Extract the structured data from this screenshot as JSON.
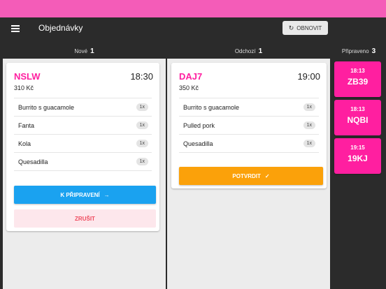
{
  "app": {
    "title": "Objednávky",
    "refresh_label": "OBNOVIT"
  },
  "columns": [
    {
      "label": "Nové",
      "count": "1"
    },
    {
      "label": "Odchozí",
      "count": "1"
    },
    {
      "label": "Připraveno",
      "count": "3"
    }
  ],
  "new_orders": [
    {
      "code": "NSLW",
      "time": "18:30",
      "price": "310 Kč",
      "items": [
        {
          "name": "Burrito s guacamole",
          "qty": "1x"
        },
        {
          "name": "Fanta",
          "qty": "1x"
        },
        {
          "name": "Kola",
          "qty": "1x"
        },
        {
          "name": "Quesadilla",
          "qty": "1x"
        }
      ],
      "prepare_label": "K PŘIPRAVENÍ",
      "cancel_label": "ZRUŠIT"
    }
  ],
  "outgoing_orders": [
    {
      "code": "DAJ7",
      "time": "19:00",
      "price": "350 Kč",
      "items": [
        {
          "name": "Burrito s guacamole",
          "qty": "1x"
        },
        {
          "name": "Pulled pork",
          "qty": "1x"
        },
        {
          "name": "Quesadilla",
          "qty": "1x"
        }
      ],
      "confirm_label": "POTVRDIT"
    }
  ],
  "ready_orders": [
    {
      "time": "18:13",
      "code": "ZB39"
    },
    {
      "time": "18:13",
      "code": "NQBI"
    },
    {
      "time": "19:15",
      "code": "19KJ"
    }
  ],
  "colors": {
    "status_bar": "#f45cb8",
    "accent_pink": "#ff1fa0",
    "primary_blue": "#1aa2f0",
    "confirm_orange": "#fba10a",
    "cancel_red": "#ef4b5e"
  },
  "icons": {
    "menu": "menu-icon",
    "refresh": "refresh-icon",
    "arrow": "arrow-right-icon",
    "check": "check-icon"
  }
}
